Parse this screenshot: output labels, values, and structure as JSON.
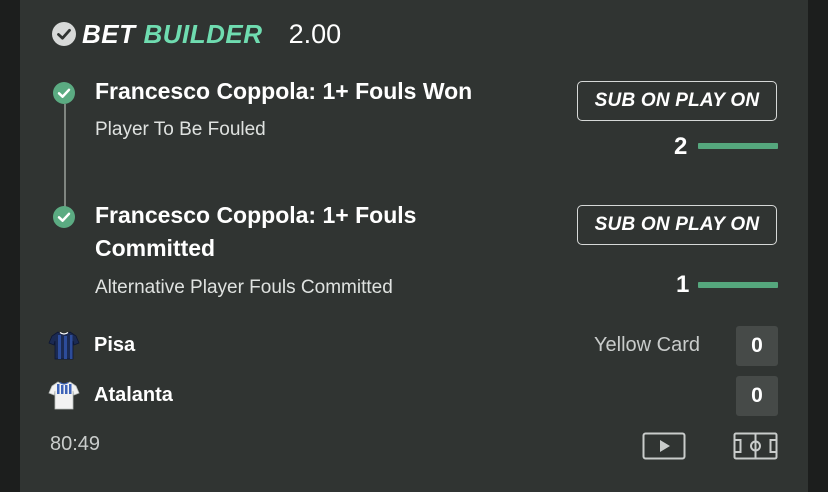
{
  "header": {
    "title_part1": "BET",
    "title_part2": "BUILDER",
    "odds": "2.00",
    "accent_color": "#6fdcb0"
  },
  "legs": [
    {
      "title": "Francesco Coppola: 1+ Fouls Won",
      "market": "Player To Be Fouled",
      "button_label": "SUB ON PLAY ON",
      "progress_value": "2",
      "progress_fraction": 1.0
    },
    {
      "title": "Francesco Coppola: 1+ Fouls Committed",
      "market": "Alternative Player Fouls Committed",
      "button_label": "SUB ON PLAY ON",
      "progress_value": "1",
      "progress_fraction": 1.0
    }
  ],
  "teams": [
    {
      "name": "Pisa",
      "score": "0",
      "shirt_icon": "pisa-shirt-icon"
    },
    {
      "name": "Atalanta",
      "score": "0",
      "shirt_icon": "atalanta-shirt-icon"
    }
  ],
  "stat_label": "Yellow Card",
  "match_time": "80:49",
  "icons": [
    "check-circle-icon",
    "video-play-icon",
    "pitch-icon"
  ]
}
